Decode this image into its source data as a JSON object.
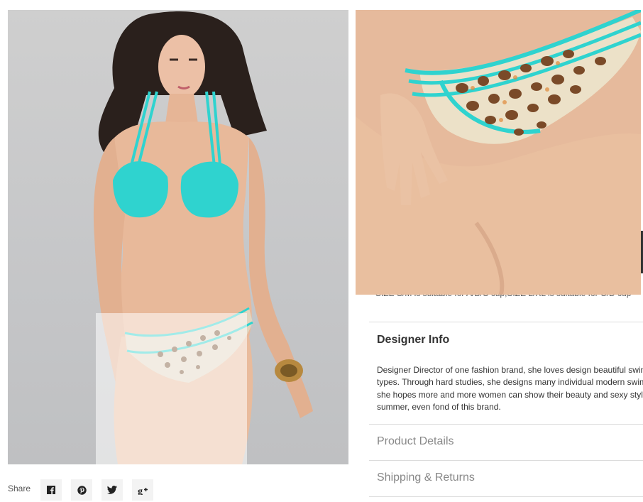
{
  "gallery": {
    "main_image_alt": "Model wearing turquoise halter bikini with leopard print bottom",
    "zoom_image_alt": "Zoomed view of leopard print bikini bottom with turquoise straps"
  },
  "share": {
    "label": "Share",
    "buttons": [
      {
        "name": "facebook",
        "icon": "facebook-icon"
      },
      {
        "name": "pinterest",
        "icon": "pinterest-icon"
      },
      {
        "name": "twitter",
        "icon": "twitter-icon"
      },
      {
        "name": "google-plus",
        "icon": "google-plus-icon"
      }
    ]
  },
  "product_info": {
    "size_note": "SIZE S/M is suitable for A/B/C cup,SIZE L/XL is suitable for C/D cup",
    "designer": {
      "title": "Designer Info",
      "lines": [
        "Designer Director of one fashion brand, she loves design beautiful swimwear",
        "types. Through hard studies, she designs many individual modern swimwear,",
        "she hopes more and more women can show their beauty and sexy style in",
        "summer, even fond of this brand."
      ]
    },
    "accordion": [
      {
        "title": "Product Details"
      },
      {
        "title": "Shipping & Returns"
      }
    ]
  },
  "colors": {
    "bikini_turquoise": "#2fd3cf",
    "skin": "#e8b99a",
    "background_gray": "#c7c8ca",
    "accordion_text": "#888888"
  }
}
